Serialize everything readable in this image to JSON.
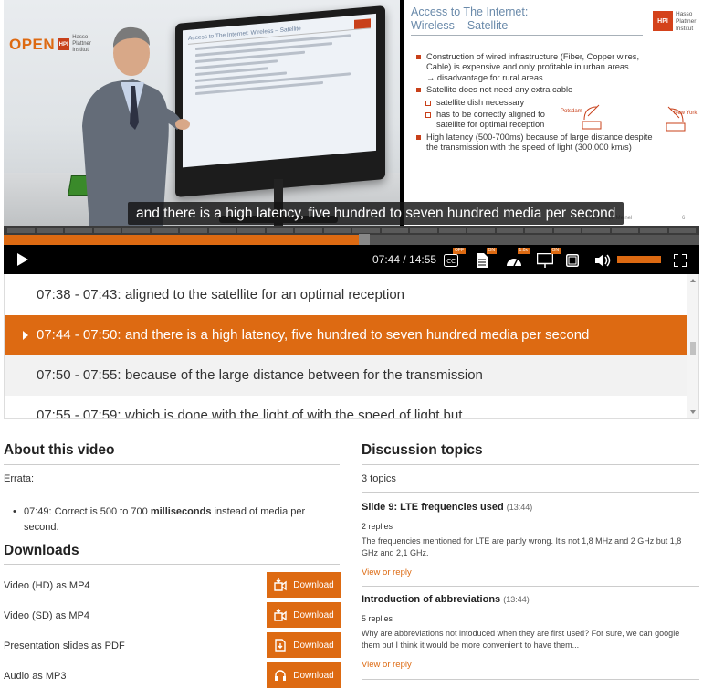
{
  "video": {
    "logo_open": "OPEN",
    "logo_hpi": "HPI",
    "logo_hpi_words": "Hasso Plattner Institut",
    "board_slide_title": "Access to The Internet: Wireless – Satellite",
    "subtitle": "and there is a high latency, five hundred to seven hundred media per second",
    "progress_fraction": 0.519,
    "slide": {
      "title": "Access to The Internet:\nWireless – Satellite",
      "hpi_badge": "HPI",
      "hpi_text": "Hasso\nPlattner\nInstitut",
      "bullets": [
        {
          "level": 1,
          "text": "Construction of wired infrastructure (Fiber, Copper wires,\nCable) is expensive and only profitable in urban areas\n→ disadvantage for rural areas"
        },
        {
          "level": 1,
          "text": "Satellite does not need any extra cable"
        },
        {
          "level": 2,
          "text": "satellite dish necessary"
        },
        {
          "level": 2,
          "text": "has to be correctly aligned to\nsatellite for optimal reception"
        },
        {
          "level": 1,
          "text": "High latency (500-700ms) because of large distance despite\nthe transmission with the speed of light (300,000 km/s)"
        }
      ],
      "diagram_left": "Potsdam",
      "diagram_right": "New York",
      "footer": "Dr. Christoph Meinel",
      "page_number": "6"
    }
  },
  "controls": {
    "time": "07:44 / 14:55",
    "icons": [
      "play-icon",
      "closed-captions-icon",
      "transcript-icon",
      "speed-icon",
      "slides-icon",
      "picture-in-picture-icon",
      "volume-icon",
      "fullscreen-icon"
    ],
    "volume_fraction": 1.0,
    "badges": {
      "cc": "OFF",
      "transcript": "ON",
      "speed": "1.0x",
      "slides": "ON"
    }
  },
  "transcript": [
    {
      "time": "07:38 - 07:43:",
      "text": "aligned to the satellite for an optimal reception",
      "active": false
    },
    {
      "time": "07:44 - 07:50:",
      "text": "and there is a high latency, five hundred to seven hundred media per second",
      "active": true
    },
    {
      "time": "07:50 - 07:55:",
      "text": "because of the large distance between for the transmission",
      "active": false
    },
    {
      "time": "07:55 - 07:59:",
      "text": "which is done with the light of with the speed of light but",
      "active": false
    }
  ],
  "about": {
    "title": "About this video",
    "errata_label": "Errata:",
    "errata_prefix": "07:49: Correct is 500 to 700 ",
    "errata_bold": "milliseconds",
    "errata_suffix": " instead of media per second."
  },
  "downloads": {
    "title": "Downloads",
    "button_label": "Download",
    "items": [
      {
        "label": "Video (HD) as MP4",
        "icon": "video-download-icon"
      },
      {
        "label": "Video (SD) as MP4",
        "icon": "video-download-icon"
      },
      {
        "label": "Presentation slides as PDF",
        "icon": "pdf-download-icon"
      },
      {
        "label": "Audio as MP3",
        "icon": "audio-download-icon"
      }
    ]
  },
  "discussion": {
    "title": "Discussion topics",
    "count": "3 topics",
    "topics": [
      {
        "title": "Slide 9: LTE frequencies used",
        "time": "(13:44)",
        "replies": "2 replies",
        "body": "The frequencies mentioned for LTE are partly wrong. It's not 1,8 MHz and 2 GHz but 1,8 GHz and 2,1 GHz.",
        "link": "View or reply"
      },
      {
        "title": "Introduction of abbreviations",
        "time": "(13:44)",
        "replies": "5 replies",
        "body": "Why are abbreviations not intoduced when they are first used? For sure, we can google them but I think it would be more convenient to have them...",
        "link": "View or reply"
      }
    ]
  },
  "colors": {
    "accent": "#dd6a12",
    "slide_red": "#c8401a",
    "slide_title": "#6a8aaa"
  }
}
